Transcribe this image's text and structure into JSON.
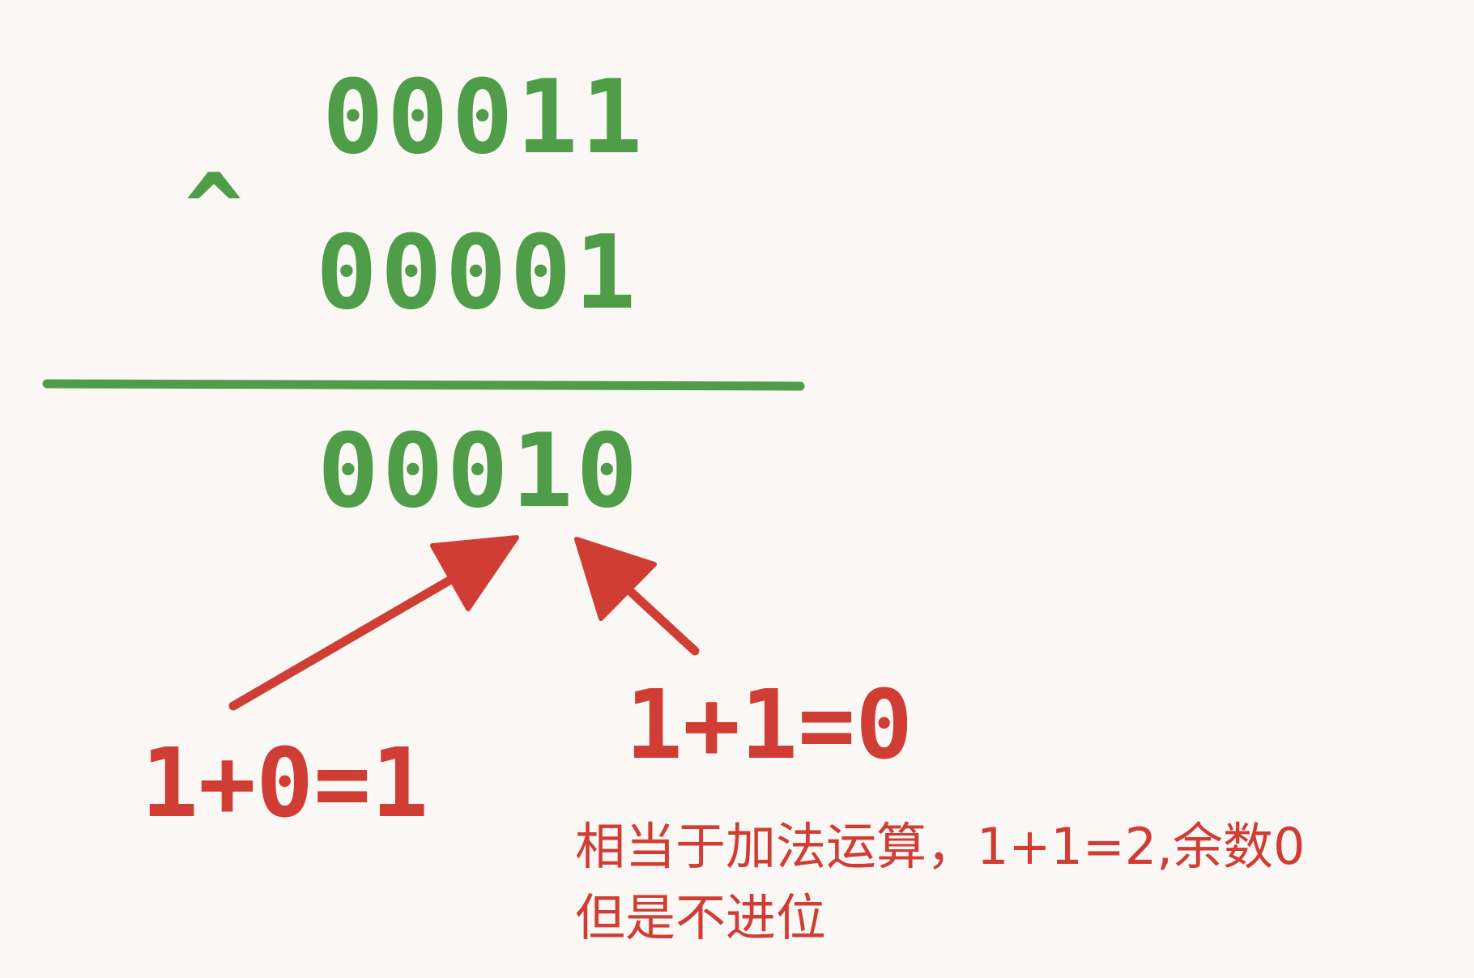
{
  "operand_1": "00011",
  "operator": "^",
  "operand_2": "00001",
  "result": "00010",
  "annotation_left": "1+0=1",
  "annotation_right": "1+1=0",
  "note_line_1": "相当于加法运算，1+1=2,余数0",
  "note_line_2": "但是不进位",
  "colors": {
    "background": "#fbf7f4",
    "binary_text": "#4f9d49",
    "annotation": "#cf3d34"
  }
}
